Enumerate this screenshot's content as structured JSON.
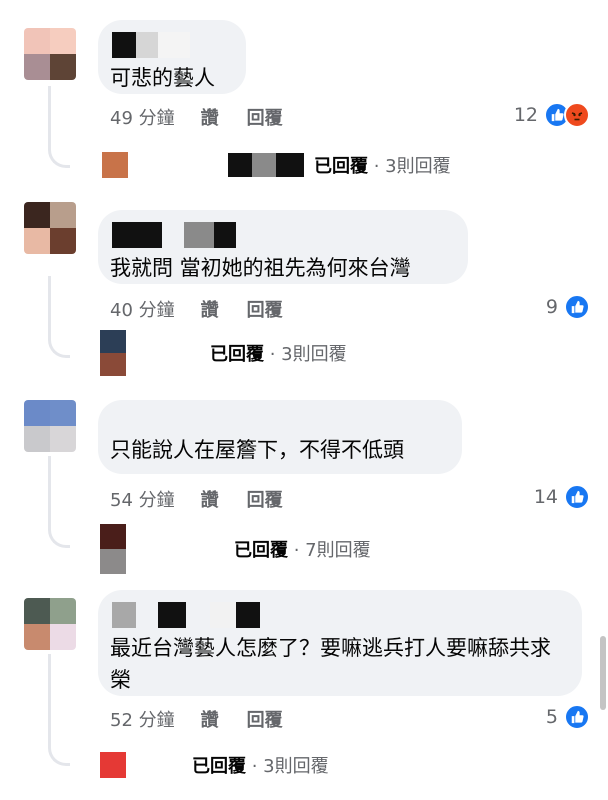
{
  "comments": [
    {
      "text": "可悲的藝人",
      "time": "49 分鐘",
      "like_label": "讚",
      "reply_label": "回覆",
      "reaction_count": "12",
      "reactions": [
        "like-icon",
        "angry-icon"
      ],
      "replies_summary": "已回覆",
      "replies_count": "· 3則回覆"
    },
    {
      "text": "我就問 當初她的祖先為何來台灣",
      "time": "40 分鐘",
      "like_label": "讚",
      "reply_label": "回覆",
      "reaction_count": "9",
      "reactions": [
        "like-icon"
      ],
      "replies_summary": "已回覆",
      "replies_count": "· 3則回覆"
    },
    {
      "text": "只能說人在屋簷下，不得不低頭",
      "time": "54 分鐘",
      "like_label": "讚",
      "reply_label": "回覆",
      "reaction_count": "14",
      "reactions": [
        "like-icon"
      ],
      "replies_summary": "已回覆",
      "replies_count": "· 7則回覆"
    },
    {
      "text": "最近台灣藝人怎麼了？要嘛逃兵打人要嘛舔共求榮",
      "time": "52 分鐘",
      "like_label": "讚",
      "reply_label": "回覆",
      "reaction_count": "5",
      "reactions": [
        "like-icon"
      ],
      "replies_summary": "已回覆",
      "replies_count": "· 3則回覆"
    }
  ],
  "colors": {
    "like_blue": "#1877f2",
    "angry_orange": "#ef4a1e",
    "bubble_bg": "#f0f2f5",
    "meta_gray": "#65676b"
  }
}
